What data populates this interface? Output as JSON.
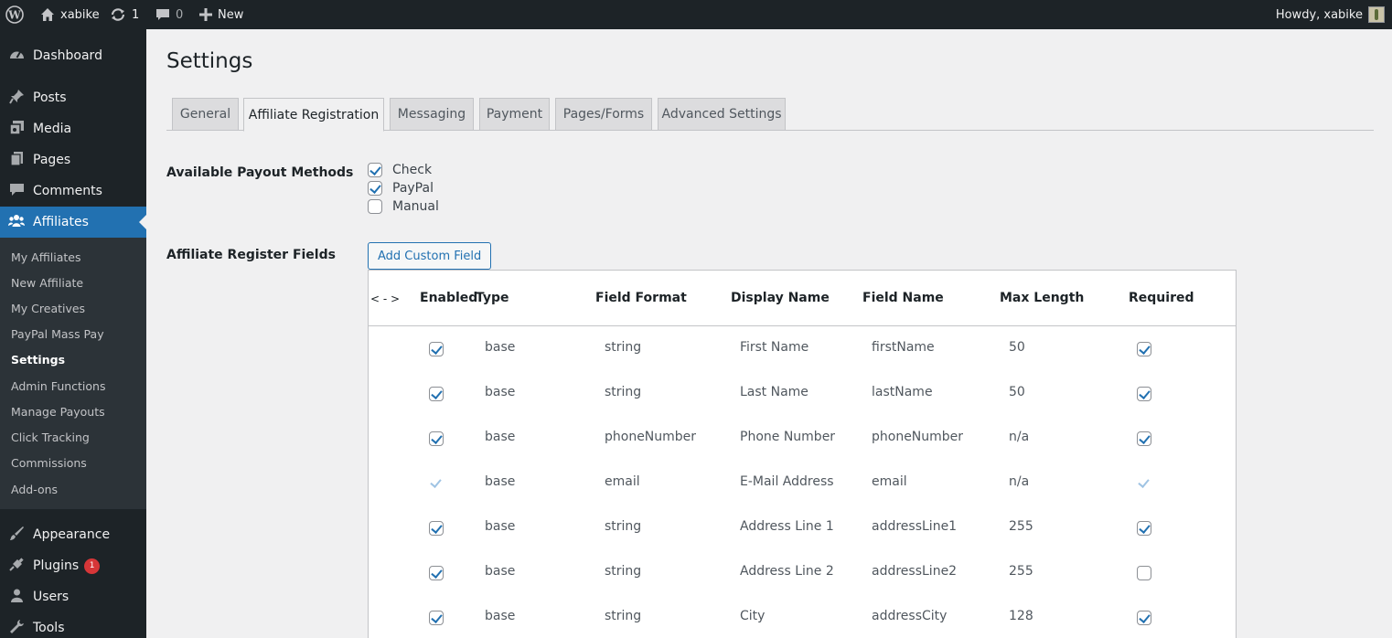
{
  "adminbar": {
    "site_name": "xabike",
    "updates_count": "1",
    "comments_count": "0",
    "new_label": "New",
    "howdy": "Howdy, xabike"
  },
  "sidebar": {
    "top_items": [
      {
        "label": "Dashboard",
        "icon": "dashboard-icon"
      },
      {
        "label": "Posts",
        "icon": "pin-icon"
      },
      {
        "label": "Media",
        "icon": "media-icon"
      },
      {
        "label": "Pages",
        "icon": "pages-icon"
      },
      {
        "label": "Comments",
        "icon": "comment-icon"
      },
      {
        "label": "Affiliates",
        "icon": "groups-icon",
        "current": true
      }
    ],
    "submenu": [
      "My Affiliates",
      "New Affiliate",
      "My Creatives",
      "PayPal Mass Pay",
      "Settings",
      "Admin Functions",
      "Manage Payouts",
      "Click Tracking",
      "Commissions",
      "Add-ons"
    ],
    "current_submenu": "Settings",
    "bottom_items": [
      {
        "label": "Appearance",
        "icon": "brush-icon"
      },
      {
        "label": "Plugins",
        "icon": "plugin-icon",
        "badge": "1"
      },
      {
        "label": "Users",
        "icon": "users-icon"
      },
      {
        "label": "Tools",
        "icon": "wrench-icon"
      }
    ]
  },
  "page": {
    "title": "Settings",
    "tabs": [
      "General",
      "Affiliate Registration",
      "Messaging",
      "Payment",
      "Pages/Forms",
      "Advanced Settings"
    ],
    "active_tab": "Affiliate Registration"
  },
  "payout": {
    "label": "Available Payout Methods",
    "options": [
      {
        "label": "Check",
        "checked": true
      },
      {
        "label": "PayPal",
        "checked": true
      },
      {
        "label": "Manual",
        "checked": false
      }
    ]
  },
  "register_fields": {
    "label": "Affiliate Register Fields",
    "add_button": "Add Custom Field",
    "headers": [
      "< - >",
      "Enabled",
      "Type",
      "Field Format",
      "Display Name",
      "Field Name",
      "Max Length",
      "Required"
    ],
    "rows": [
      {
        "enabled": true,
        "type": "base",
        "format": "string",
        "display": "First Name",
        "name": "firstName",
        "max": "50",
        "required": true,
        "locked": false
      },
      {
        "enabled": true,
        "type": "base",
        "format": "string",
        "display": "Last Name",
        "name": "lastName",
        "max": "50",
        "required": true,
        "locked": false
      },
      {
        "enabled": true,
        "type": "base",
        "format": "phoneNumber",
        "display": "Phone Number",
        "name": "phoneNumber",
        "max": "n/a",
        "required": true,
        "locked": false
      },
      {
        "enabled": true,
        "type": "base",
        "format": "email",
        "display": "E-Mail Address",
        "name": "email",
        "max": "n/a",
        "required": true,
        "locked": true
      },
      {
        "enabled": true,
        "type": "base",
        "format": "string",
        "display": "Address Line 1",
        "name": "addressLine1",
        "max": "255",
        "required": true,
        "locked": false
      },
      {
        "enabled": true,
        "type": "base",
        "format": "string",
        "display": "Address Line 2",
        "name": "addressLine2",
        "max": "255",
        "required": false,
        "locked": false
      },
      {
        "enabled": true,
        "type": "base",
        "format": "string",
        "display": "City",
        "name": "addressCity",
        "max": "128",
        "required": true,
        "locked": false
      }
    ]
  },
  "colors": {
    "admin_dark": "#1d2327",
    "accent_blue": "#2271b1",
    "badge_red": "#d63638"
  }
}
